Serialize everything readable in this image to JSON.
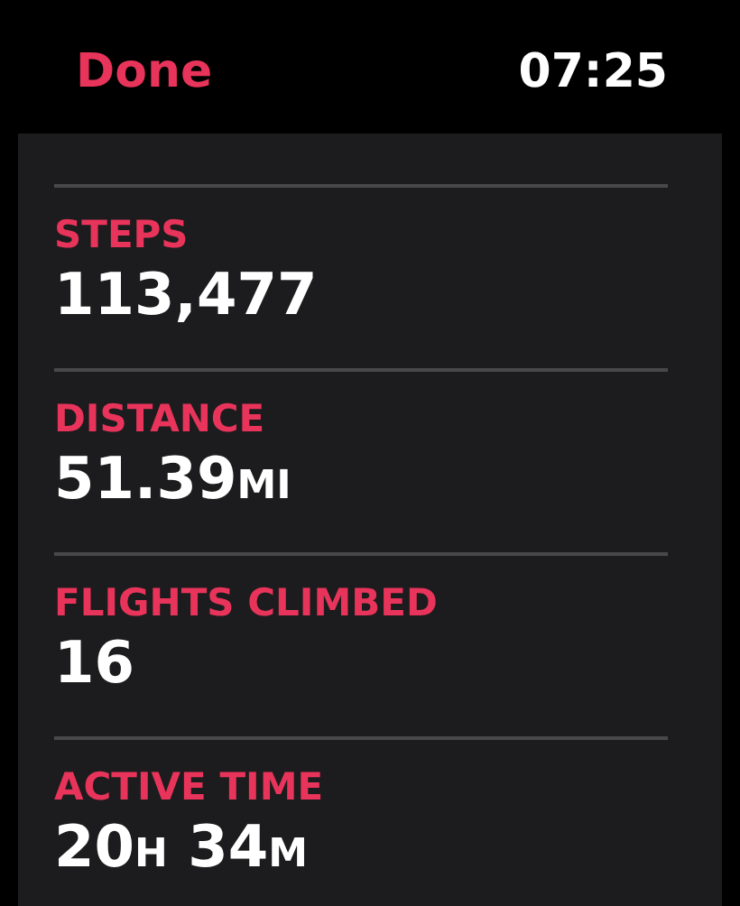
{
  "header": {
    "done": "Done",
    "time": "07:25"
  },
  "metrics": [
    {
      "label": "STEPS",
      "value": [
        {
          "num": "113,477"
        }
      ]
    },
    {
      "label": "DISTANCE",
      "value": [
        {
          "num": "51.39",
          "unit": "MI"
        }
      ]
    },
    {
      "label": "FLIGHTS CLIMBED",
      "value": [
        {
          "num": "16"
        }
      ]
    },
    {
      "label": "ACTIVE TIME",
      "value": [
        {
          "num": "20",
          "unit": "H"
        },
        {
          "num": "34",
          "unit": "M"
        }
      ]
    }
  ]
}
